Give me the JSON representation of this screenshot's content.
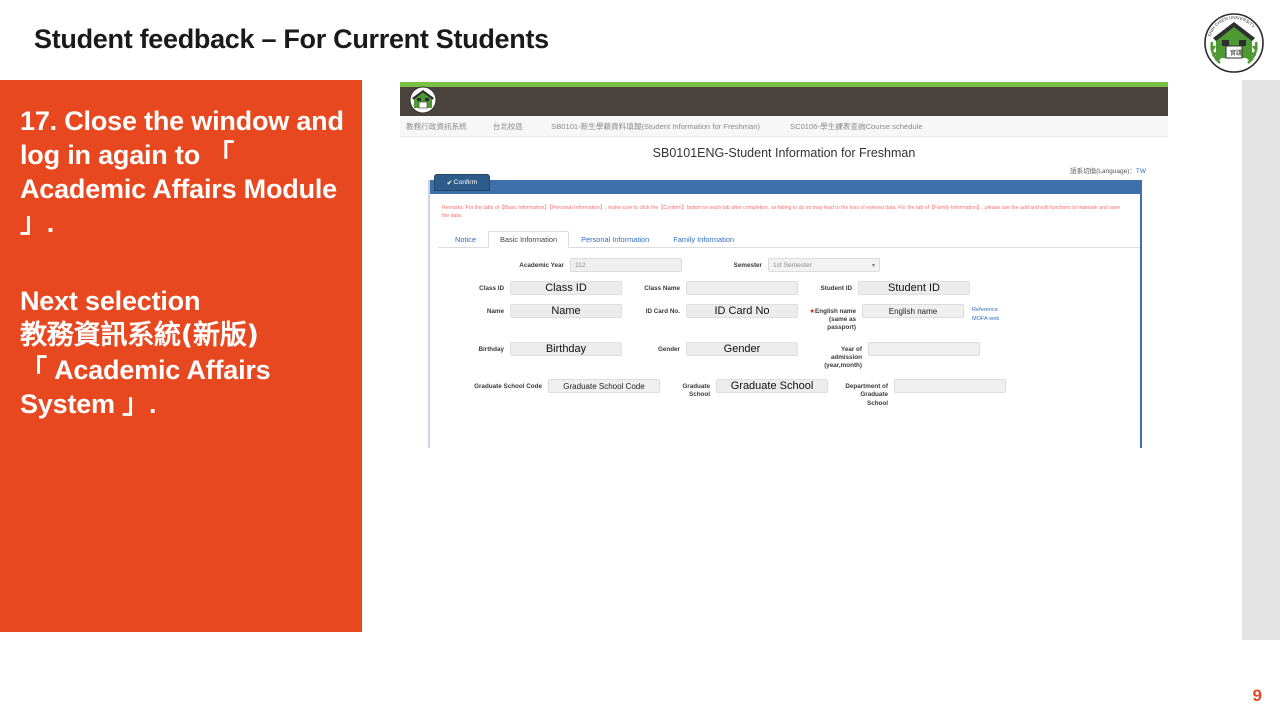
{
  "slide": {
    "title": "Student feedback – For Current Students",
    "page_number": "9",
    "accent_color": "#e8481f"
  },
  "logo": {
    "name": "shih-chien-university-logo",
    "text": "SHIH CHIEN UNIVERSITY"
  },
  "callout": {
    "paragraph1": "17. Close the window and log in again to 「 Academic Affairs Module 」.",
    "paragraph2_line1": "Next selection",
    "paragraph2_line2": "教務資訊系統(新版)",
    "paragraph2_line3": "「 Academic Affairs System 」."
  },
  "screenshot": {
    "breadcrumb": [
      "教務行政資訊系統",
      "台北校區",
      "SB0101-新生學籍資料填報(Student Information for Freshman)",
      "SC0106-學生課表查詢Course schedule"
    ],
    "page_title": "SB0101ENG-Student Information for Freshman",
    "language_label": "語系切換(Language)：",
    "language_value": "TW",
    "confirm_button": "Confirm",
    "remarks": "Remarks: For the tabs of【Basic Information】【Personal Information】, make sure to click the【Confirm】button on each tab after completion, as failing to do so may lead to the loss of entered data. For the tab of【Family Information】, please use the add and edit functions to maintain and save the data.",
    "tabs": [
      {
        "label": "Notice",
        "active": false
      },
      {
        "label": "Basic Information",
        "active": true
      },
      {
        "label": "Personal Information",
        "active": false
      },
      {
        "label": "Family Information",
        "active": false
      }
    ],
    "fields": {
      "academic_year_label": "Academic Year",
      "academic_year_value": "112",
      "semester_label": "Semester",
      "semester_value": "1st Semester",
      "class_id_label": "Class ID",
      "class_id_value": "Class  ID",
      "class_name_label": "Class Name",
      "class_name_value": "",
      "student_id_label": "Student ID",
      "student_id_value": "Student ID",
      "name_label": "Name",
      "name_value": "Name",
      "id_card_label": "ID Card No.",
      "id_card_value": "ID Card No",
      "english_name_label": "English name (same as passport)",
      "english_name_value": "English  name",
      "reference_link_line1": "Reference",
      "reference_link_line2": "MOFA web",
      "birthday_label": "Birthday",
      "birthday_value": "Birthday",
      "gender_label": "Gender",
      "gender_value": "Gender",
      "year_admission_label": "Year of admission (year,month)",
      "year_admission_value": "",
      "grad_school_code_label": "Graduate School Code",
      "grad_school_code_value": "Graduate  School Code",
      "grad_school_label": "Graduate School",
      "grad_school_value": "Graduate School",
      "dept_grad_school_label": "Department of Graduate School",
      "dept_grad_school_value": ""
    }
  }
}
